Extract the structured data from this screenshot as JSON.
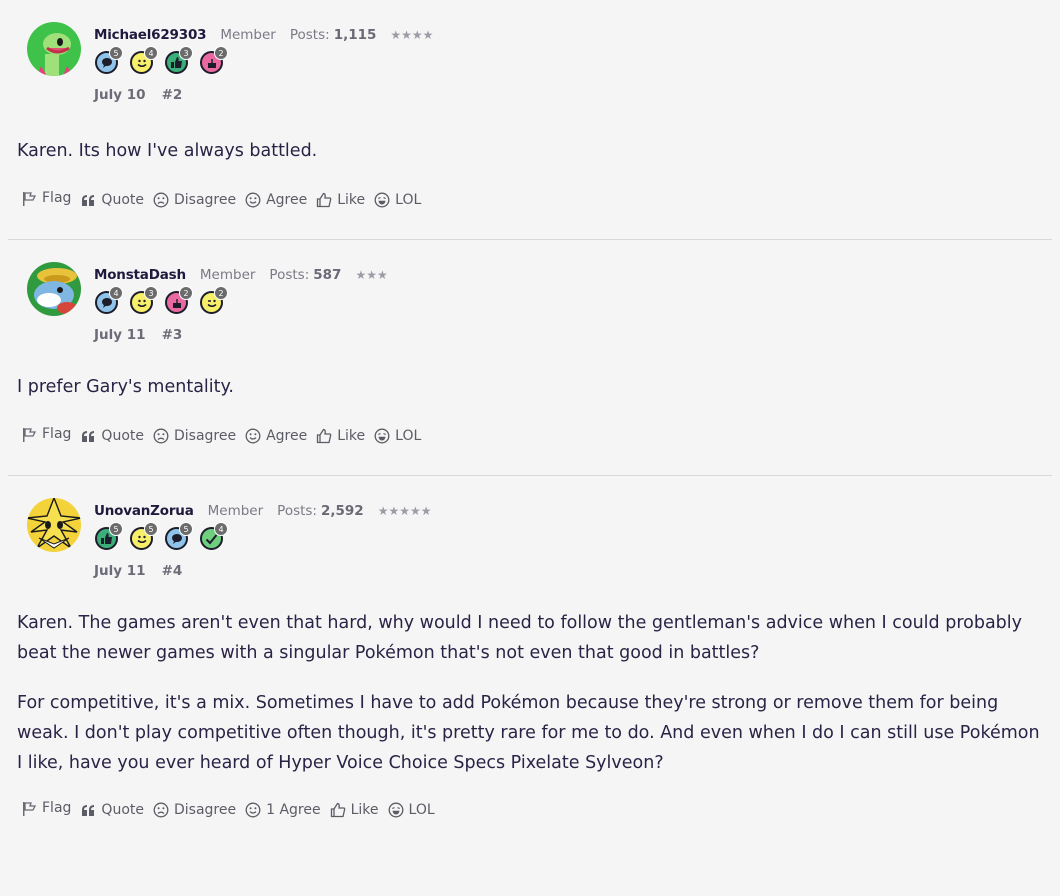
{
  "posts": [
    {
      "username": "Michael629303",
      "role": "Member",
      "posts_label": "Posts:",
      "posts_count": "1,115",
      "stars": "★★★★",
      "badges": [
        {
          "icon": "speech-bubble-icon",
          "count": "5",
          "color": "#8fc3ea",
          "glyph": "💬"
        },
        {
          "icon": "smiley-icon",
          "count": "4",
          "color": "#f7ee6a",
          "glyph": "☺"
        },
        {
          "icon": "thumbs-up-icon",
          "count": "3",
          "color": "#3cae7a",
          "glyph": "👍"
        },
        {
          "icon": "cake-icon",
          "count": "2",
          "color": "#e86aa0",
          "glyph": "🎂"
        }
      ],
      "date": "July 10",
      "number": "#2",
      "body": [
        "Karen. Its how I've always battled."
      ],
      "actions": {
        "flag": "Flag",
        "quote": "Quote",
        "disagree": "Disagree",
        "agree": "Agree",
        "like": "Like",
        "lol": "LOL"
      }
    },
    {
      "username": "MonstaDash",
      "role": "Member",
      "posts_label": "Posts:",
      "posts_count": "587",
      "stars": "★★★",
      "badges": [
        {
          "icon": "speech-bubble-icon",
          "count": "4",
          "color": "#8fc3ea",
          "glyph": "💬"
        },
        {
          "icon": "smiley-icon",
          "count": "3",
          "color": "#f7ee6a",
          "glyph": "☺"
        },
        {
          "icon": "cake-icon",
          "count": "2",
          "color": "#e86aa0",
          "glyph": "🎂"
        },
        {
          "icon": "wink-icon",
          "count": "2",
          "color": "#f7ee6a",
          "glyph": "😉"
        }
      ],
      "date": "July 11",
      "number": "#3",
      "body": [
        "I prefer Gary's mentality."
      ],
      "actions": {
        "flag": "Flag",
        "quote": "Quote",
        "disagree": "Disagree",
        "agree": "Agree",
        "like": "Like",
        "lol": "LOL"
      }
    },
    {
      "username": "UnovanZorua",
      "role": "Member",
      "posts_label": "Posts:",
      "posts_count": "2,592",
      "stars": "★★★★★",
      "badges": [
        {
          "icon": "thumbs-up-icon",
          "count": "5",
          "color": "#3cae7a",
          "glyph": "👍"
        },
        {
          "icon": "smiley-icon",
          "count": "5",
          "color": "#f7ee6a",
          "glyph": "☺"
        },
        {
          "icon": "speech-bubble-icon",
          "count": "5",
          "color": "#8fc3ea",
          "glyph": "💬"
        },
        {
          "icon": "checkmark-icon",
          "count": "4",
          "color": "#6fcf7f",
          "glyph": "✓"
        }
      ],
      "date": "July 11",
      "number": "#4",
      "body": [
        "Karen. The games aren't even that hard, why would I need to follow the gentleman's advice when I could probably beat the newer games with a singular Pokémon that's not even that good in battles?",
        "For competitive, it's a mix. Sometimes I have to add Pokémon because they're strong or remove them for being weak. I don't play competitive often though, it's pretty rare for me to do. And even when I do I can still use Pokémon I like, have you ever heard of Hyper Voice Choice Specs Pixelate Sylveon?"
      ],
      "actions": {
        "flag": "Flag",
        "quote": "Quote",
        "disagree": "Disagree",
        "agree": "1 Agree",
        "like": "Like",
        "lol": "LOL"
      }
    }
  ]
}
